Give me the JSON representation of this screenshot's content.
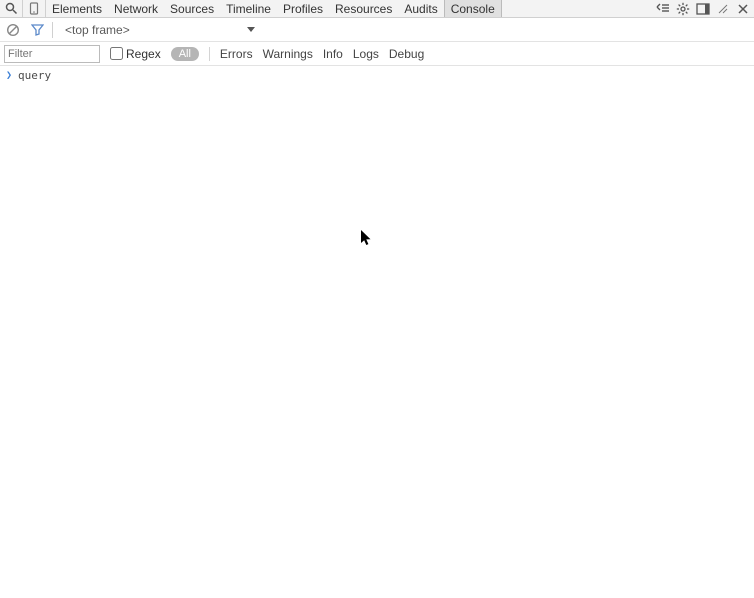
{
  "top_bar": {
    "tabs": [
      "Elements",
      "Network",
      "Sources",
      "Timeline",
      "Profiles",
      "Resources",
      "Audits",
      "Console"
    ],
    "active_tab": "Console"
  },
  "console_toolbar": {
    "frame_label": "<top frame>",
    "filter_placeholder": "Filter",
    "regex_label": "Regex",
    "levels": {
      "all": "All",
      "errors": "Errors",
      "warnings": "Warnings",
      "info": "Info",
      "logs": "Logs",
      "debug": "Debug"
    }
  },
  "console": {
    "prompt_value": "query"
  }
}
